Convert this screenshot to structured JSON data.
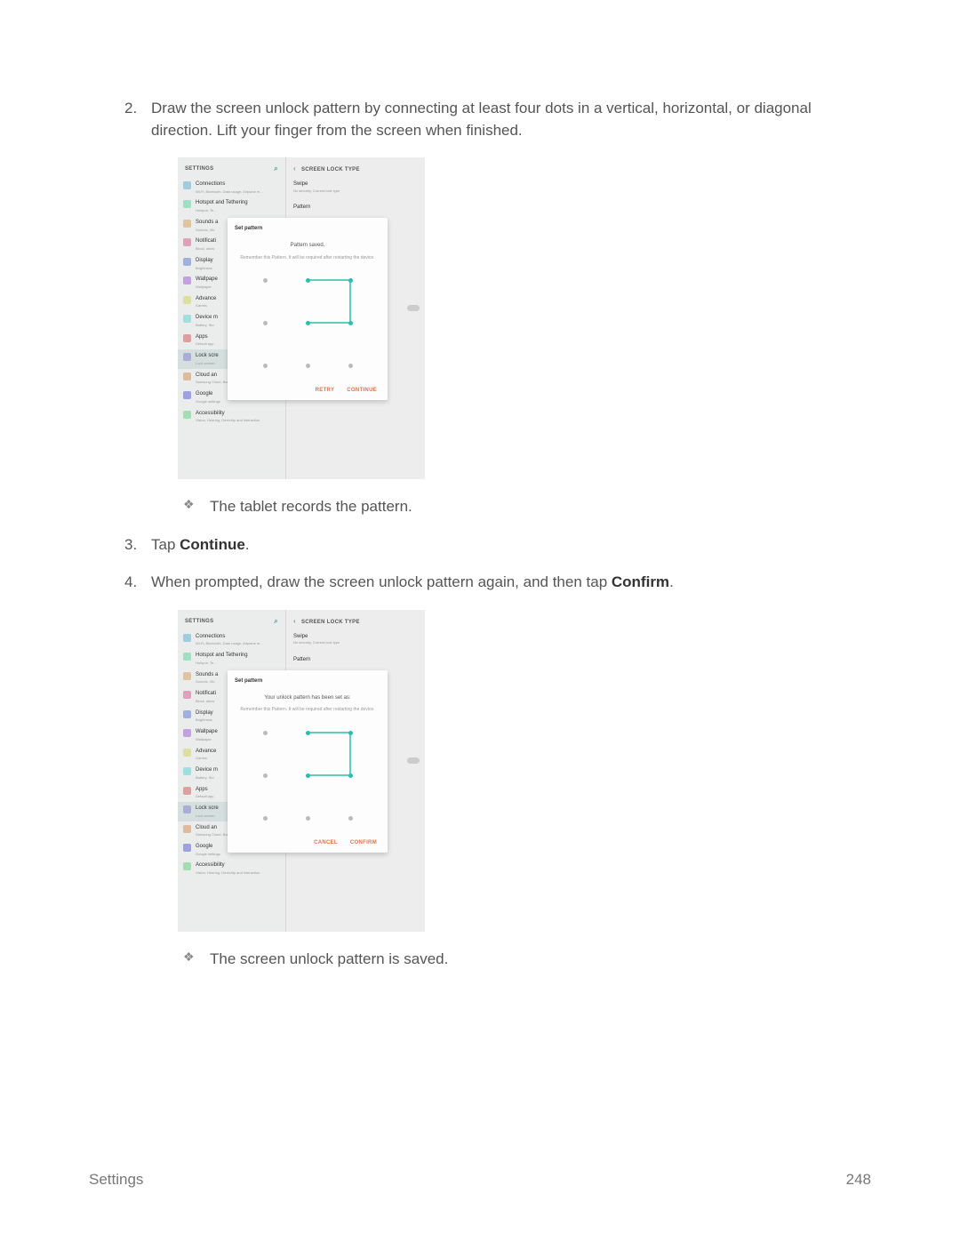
{
  "steps": {
    "s2": "Draw the screen unlock pattern by connecting at least four dots in a vertical, horizontal, or diagonal direction. Lift your finger from the screen when finished.",
    "s2_result": "The tablet records the pattern.",
    "s3_prefix": "Tap ",
    "s3_bold": "Continue",
    "s3_suffix": ".",
    "s4_prefix": "When prompted, draw the screen unlock pattern again, and then tap ",
    "s4_bold": "Confirm",
    "s4_suffix": ".",
    "s4_result": "The screen unlock pattern is saved."
  },
  "screenshot": {
    "settings_label": "SETTINGS",
    "lock_type_label": "SCREEN LOCK TYPE",
    "swipe": {
      "title": "Swipe",
      "sub": "No security, Current lock type"
    },
    "pattern": {
      "title": "Pattern"
    },
    "sidebar": [
      {
        "title": "Connections",
        "sub": "Wi-Fi, Bluetooth, Data usage, Airplane m..."
      },
      {
        "title": "Hotspot and Tethering",
        "sub": "Hotspot, Te..."
      },
      {
        "title": "Sounds a",
        "sub": "Sounds, Vib"
      },
      {
        "title": "Notificati",
        "sub": "Block, allow"
      },
      {
        "title": "Display",
        "sub": "Brightness"
      },
      {
        "title": "Wallpape",
        "sub": "Wallpaper"
      },
      {
        "title": "Advance",
        "sub": "Games"
      },
      {
        "title": "Device m",
        "sub": "Battery, Sto"
      },
      {
        "title": "Apps",
        "sub": "Default app"
      },
      {
        "title": "Lock scre",
        "sub": "Lock screen"
      },
      {
        "title": "Cloud an",
        "sub": "Samsung Cloud, Backup and restore"
      },
      {
        "title": "Google",
        "sub": "Google settings"
      },
      {
        "title": "Accessibility",
        "sub": "Vision, Hearing, Dexterity and interaction"
      }
    ],
    "modal1": {
      "title": "Set pattern",
      "status": "Pattern saved.",
      "hint": "Remember this Pattern. It will be required after restarting the device.",
      "btn1": "RETRY",
      "btn2": "CONTINUE"
    },
    "modal2": {
      "title": "Set pattern",
      "status": "Your unlock pattern has been set as:",
      "hint": "Remember this Pattern. It will be required after restarting the device.",
      "btn1": "CANCEL",
      "btn2": "CONFIRM"
    }
  },
  "footer": {
    "left": "Settings",
    "right": "248"
  },
  "icon_colors": [
    "#6db5d6",
    "#6dd6a8",
    "#d6a86d",
    "#d66d9a",
    "#6d8ad6",
    "#a86dd6",
    "#d6d66d",
    "#6dd6d6",
    "#d66d6d",
    "#8a8ad6",
    "#d69a6d",
    "#6d6dd6",
    "#6dd68a"
  ]
}
